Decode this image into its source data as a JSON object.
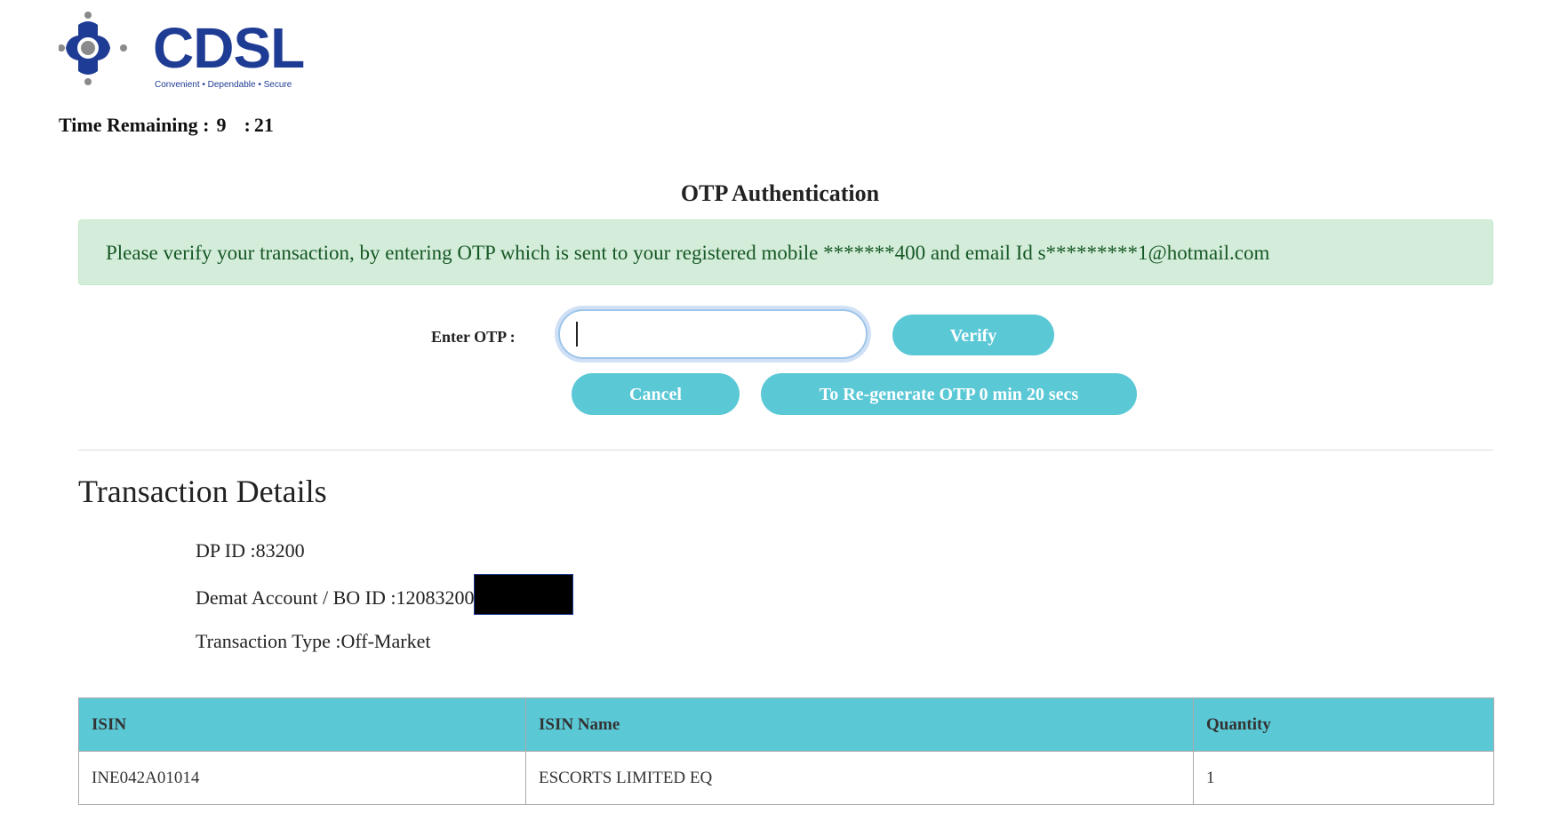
{
  "brand": {
    "name": "CDSL",
    "tagline": "Convenient  •  Dependable  •  Secure",
    "color": "#1f3c94"
  },
  "timer": {
    "label": "Time Remaining :",
    "minutes": "9",
    "separator": ":",
    "seconds": "21"
  },
  "otp": {
    "title": "OTP Authentication",
    "message": "Please verify your transaction, by entering OTP which is sent to your registered mobile *******400 and email Id s*********1@hotmail.com",
    "input_label": "Enter OTP :",
    "input_value": "",
    "verify_label": "Verify",
    "cancel_label": "Cancel",
    "regenerate_label": "To Re-generate OTP 0 min 20 secs",
    "button_color": "#5bc8d6",
    "alert_bg": "#d4edda"
  },
  "transaction": {
    "title": "Transaction Details",
    "dp_id": "DP ID :83200",
    "bo_id": "Demat Account / BO ID :12083200",
    "type": "Transaction Type :Off-Market",
    "table": {
      "headers": [
        "ISIN",
        "ISIN Name",
        "Quantity"
      ],
      "rows": [
        [
          "INE042A01014",
          "ESCORTS LIMITED EQ",
          "1"
        ]
      ]
    }
  }
}
